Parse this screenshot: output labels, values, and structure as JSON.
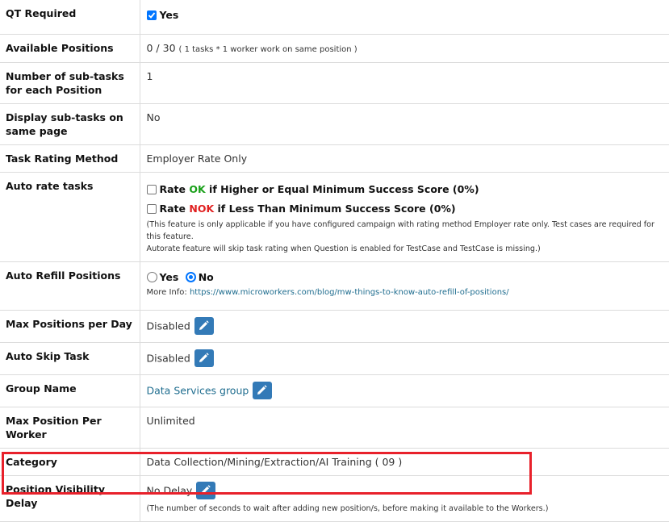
{
  "rows": {
    "qt_required": {
      "label": "QT Required",
      "value": "Yes"
    },
    "available_positions": {
      "label": "Available Positions",
      "value": "0 / 30",
      "note": "( 1 tasks * 1 worker work on same position )"
    },
    "subtasks": {
      "label": "Number of sub-tasks for each Position",
      "value": "1"
    },
    "display_subtasks": {
      "label": "Display sub-tasks on same page",
      "value": "No"
    },
    "rating_method": {
      "label": "Task Rating Method",
      "value": "Employer Rate Only"
    },
    "auto_rate": {
      "label": "Auto rate tasks",
      "opt1_pre": "Rate ",
      "opt1_key": "OK",
      "opt1_post": " if Higher or Equal Minimum Success Score (0%)",
      "opt2_pre": "Rate ",
      "opt2_key": "NOK",
      "opt2_post": " if Less Than Minimum Success Score (0%)",
      "note1": "(This feature is only applicable if you have configured campaign with rating method Employer rate only. Test cases are required for this feature.",
      "note2": "Autorate feature will skip task rating when Question is enabled for TestCase and TestCase is missing.)"
    },
    "auto_refill": {
      "label": "Auto Refill Positions",
      "yes": "Yes",
      "no": "No",
      "info_label": "More Info:",
      "info_link": "https://www.microworkers.com/blog/mw-things-to-know-auto-refill-of-positions/"
    },
    "max_per_day": {
      "label": "Max Positions per Day",
      "value": "Disabled"
    },
    "auto_skip": {
      "label": "Auto Skip Task",
      "value": "Disabled"
    },
    "group_name": {
      "label": "Group Name",
      "value": "Data Services group"
    },
    "max_per_worker": {
      "label": "Max Position Per Worker",
      "value": "Unlimited"
    },
    "category": {
      "label": "Category",
      "value": "Data Collection/Mining/Extraction/AI Training ( 09 )"
    },
    "visibility_delay": {
      "label": "Position Visibility Delay",
      "value": "No Delay",
      "note": "(The number of seconds to wait after adding new position/s, before making it available to the Workers.)"
    }
  },
  "colors": {
    "accent": "#337ab7",
    "ok": "#1aa01a",
    "nok": "#e02020",
    "highlight": "#e8212b",
    "link": "#1f6d8f"
  }
}
